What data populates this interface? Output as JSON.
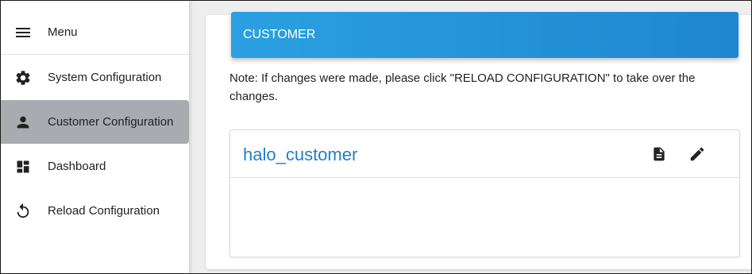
{
  "sidebar": {
    "menu": {
      "label": "Menu",
      "icon": "menu-icon"
    },
    "items": [
      {
        "label": "System Configuration",
        "icon": "gear-icon"
      },
      {
        "label": "Customer Configuration",
        "icon": "person-icon",
        "active": true
      },
      {
        "label": "Dashboard",
        "icon": "dashboard-icon"
      },
      {
        "label": "Reload Configuration",
        "icon": "reload-icon"
      }
    ]
  },
  "main": {
    "header_title": "CUSTOMER",
    "note": "Note: If changes were made, please click \"RELOAD CONFIGURATION\" to take over the changes.",
    "customer_card": {
      "title": "halo_customer",
      "actions": [
        {
          "icon": "document-icon"
        },
        {
          "icon": "edit-pencil-icon"
        }
      ]
    }
  },
  "colors": {
    "accent": "#1f86d0",
    "active_nav_bg": "#a9abb0",
    "link_title": "#1f7fc7"
  }
}
